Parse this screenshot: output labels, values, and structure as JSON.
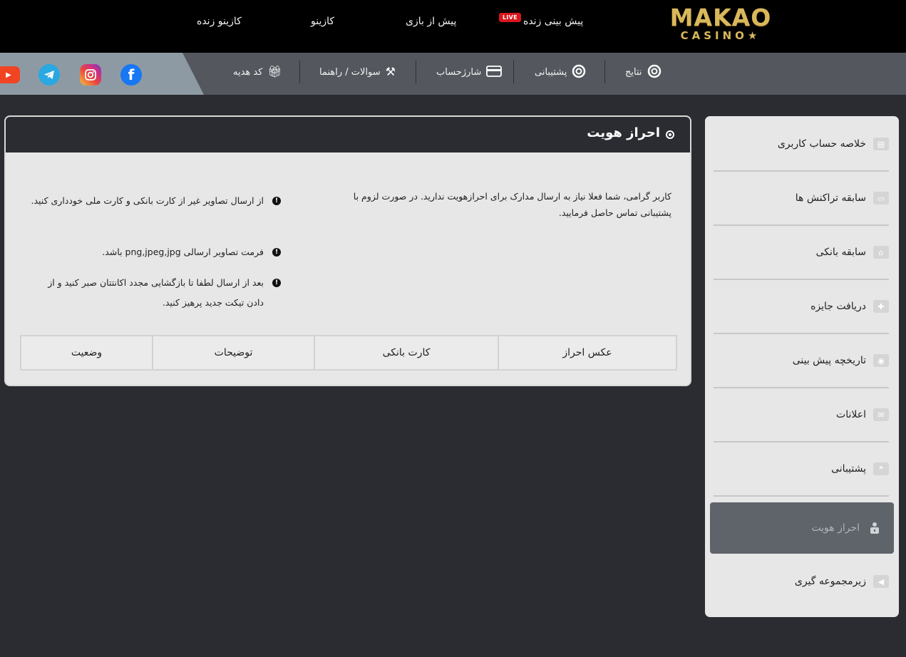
{
  "logo": {
    "main": "MAKAO",
    "sub": "CASINO★"
  },
  "topnav": {
    "live_casino": "کازینو زنده",
    "casino": "کازینو",
    "pre_match": "پیش از بازی",
    "live_betting": "پیش بینی زنده",
    "live_badge": "LIVE"
  },
  "subnav": {
    "results": "نتایج",
    "support": "پشتیبانی",
    "deposit": "شارژحساب",
    "faq": "سوالات / راهنما",
    "gift_code": "کد هدیه"
  },
  "socials": {
    "youtube": "youtube-icon",
    "telegram": "telegram-icon",
    "instagram": "instagram-icon",
    "facebook": "facebook-icon"
  },
  "sidebar": {
    "items": [
      {
        "label": "خلاصه حساب کاربری",
        "icon": "id-card-icon"
      },
      {
        "label": "سابقه تراکنش ها",
        "icon": "credit-card-icon"
      },
      {
        "label": "سابقه بانکی",
        "icon": "bank-icon"
      },
      {
        "label": "دریافت جایزه",
        "icon": "gift-icon"
      },
      {
        "label": "تاریخچه پیش بینی",
        "icon": "ball-icon"
      },
      {
        "label": "اعلانات",
        "icon": "envelope-icon"
      },
      {
        "label": "پشتیبانی",
        "icon": "chat-icon"
      },
      {
        "label": "احراز هویت",
        "icon": "user-lock-icon"
      },
      {
        "label": "زیرمجموعه گیری",
        "icon": "megaphone-icon"
      }
    ]
  },
  "panel": {
    "title": "احراز هویت",
    "info": "کاربر گرامی، شما فعلا نیاز به ارسال مدارک برای احرازهویت ندارید. در صورت لزوم با پشتیبانی تماس حاصل فرمایید.",
    "notes": [
      "از ارسال تصاویر غیر از کارت بانکی و کارت ملی خودداری کنید.",
      "فرمت تصاویر ارسالی png,jpeg,jpg باشد.",
      "بعد از ارسال لطفا تا بازگشایی مجدد اکانتتان صبر کنید و از دادن تیکت جدید پرهیز کنید."
    ],
    "table_headers": [
      "عکس احراز",
      "کارت بانکی",
      "توضیحات",
      "وضعیت"
    ]
  },
  "colors": {
    "header_bg": "#000000",
    "subbar_bg": "#54585e",
    "page_bg": "#2a2c31",
    "live_red": "#d9151b",
    "logo_gold": "#d9b85c"
  }
}
